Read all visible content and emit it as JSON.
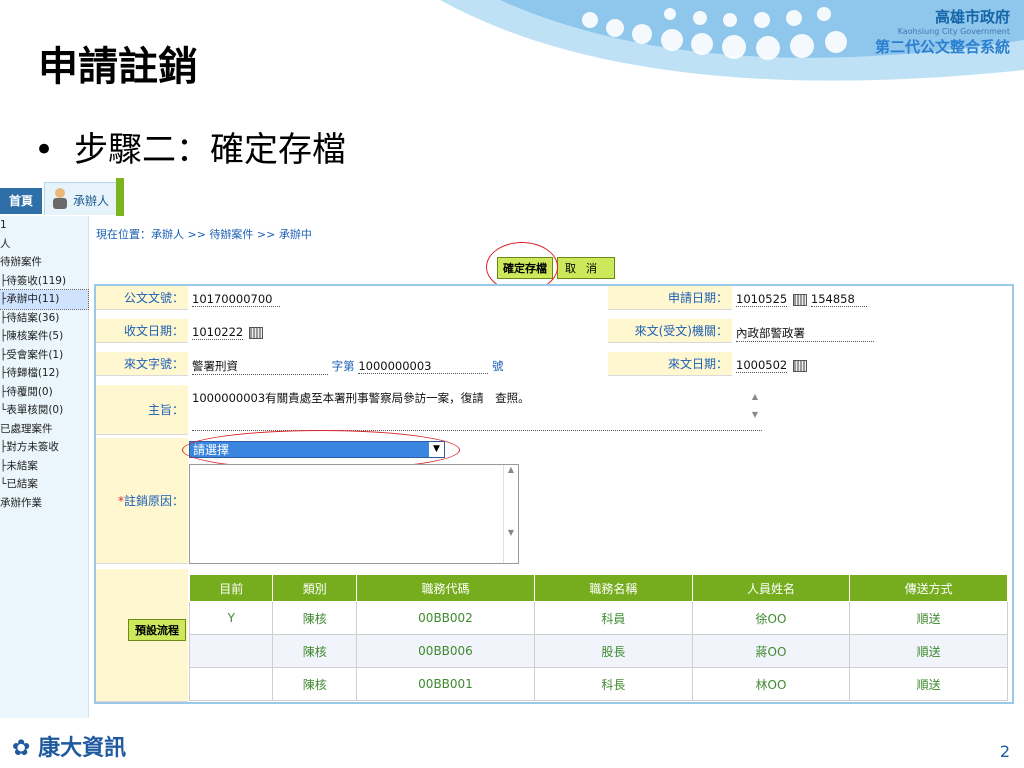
{
  "slide": {
    "title": "申請註銷",
    "bullet": "步驟二：確定存檔",
    "page_number": "2"
  },
  "branding": {
    "org_name": "高雄市政府",
    "org_english": "Kaohsiung City Government",
    "system_name": "第二代公文整合系統",
    "footer_company": "康大資訊"
  },
  "app": {
    "tabs": {
      "home": "首頁",
      "user": "承辦人"
    },
    "sidebar": {
      "items": [
        "1",
        "人",
        "待辦案件",
        "├待簽收(119)",
        "├承辦中(11)",
        "├待結案(36)",
        "├陳核案件(5)",
        "├受會案件(1)",
        "├待歸檔(12)",
        "├待覆閱(0)",
        "└表單核閱(0)",
        "已處理案件",
        "├對方未簽收",
        "├未結案",
        "└已結案",
        "承辦作業"
      ]
    },
    "breadcrumb": "現在位置：承辦人 >> 待辦案件 >> 承辦中",
    "buttons": {
      "save": "確定存檔",
      "cancel": "取消",
      "preset_flow": "預設流程"
    },
    "form": {
      "doc_no_label": "公文文號：",
      "doc_no": "10170000700",
      "apply_date_label": "申請日期：",
      "apply_date": "1010525",
      "apply_time": "154858",
      "recv_date_label": "收文日期：",
      "recv_date": "1010222",
      "source_org_label": "來文(受文)機關：",
      "source_org": "內政部警政署",
      "doc_word_label": "來文字號：",
      "doc_word": "警署刑資",
      "word_mark": "字第",
      "doc_word_no": "1000000003",
      "no_mark": "號",
      "source_date_label": "來文日期：",
      "source_date": "1000502",
      "subject_label": "主旨：",
      "subject": "1000000003有關貴處至本署刑事警察局參訪一案，復請　查照。",
      "reason_required": "*",
      "reason_label": "註銷原因：",
      "reason_select": "請選擇"
    },
    "flow_table": {
      "headers": [
        "目前",
        "類別",
        "職務代碼",
        "職務名稱",
        "人員姓名",
        "傳送方式"
      ],
      "rows": [
        [
          "Y",
          "陳核",
          "00BB002",
          "科員",
          "徐OO",
          "順送"
        ],
        [
          "",
          "陳核",
          "00BB006",
          "股長",
          "蔣OO",
          "順送"
        ],
        [
          "",
          "陳核",
          "00BB001",
          "科長",
          "林OO",
          "順送"
        ]
      ]
    }
  },
  "colors": {
    "accent_green": "#76ad1f",
    "label_bg": "#fff7cf",
    "link_blue": "#1b5fb5",
    "highlight_red": "#d9262b"
  }
}
